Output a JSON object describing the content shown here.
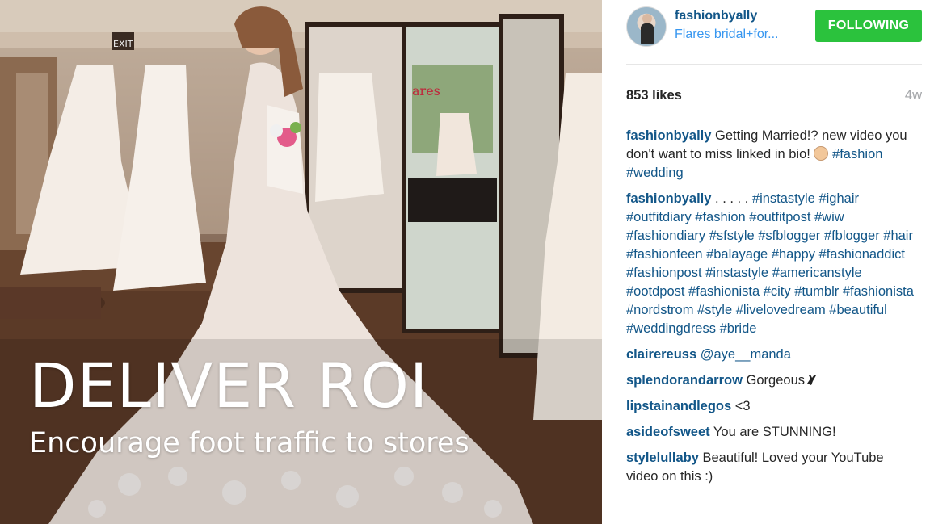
{
  "photo": {
    "headline": "DELIVER ROI",
    "subheadline": "Encourage foot traffic to stores",
    "exit_sign": "EXIT",
    "window_sign": "ares"
  },
  "post": {
    "username": "fashionbyally",
    "location": "Flares bridal+for...",
    "follow_label": "FOLLOWING",
    "likes": "853 likes",
    "age": "4w",
    "colors": {
      "follow_button": "#2bc23d",
      "username": "#125688",
      "location": "#3897f0"
    }
  },
  "comments": [
    {
      "user": "fashionbyally",
      "text": "Getting Married!? new video you don't want to miss linked in bio!",
      "emoji": "face-emoji",
      "tags": "#fashion #wedding"
    },
    {
      "user": "fashionbyally",
      "text": ". . . . .",
      "tags": "#instastyle #ighair #outfitdiary #fashion #outfitpost #wiw #fashiondiary #sfstyle #sfblogger #fblogger #hair #fashionfeen #balayage #happy #fashionaddict #fashionpost #instastyle #americanstyle #ootdpost #fashionista #city #tumblr #fashionista #nordstrom #style #livelovedream #beautiful #weddingdress #bride"
    },
    {
      "user": "clairereuss",
      "text": "@aye__manda"
    },
    {
      "user": "splendorandarrow",
      "text": "Gorgeous",
      "emoji": "ok-hand-emoji"
    },
    {
      "user": "lipstainandlegos",
      "text": "<3"
    },
    {
      "user": "asideofsweet",
      "text": "You are STUNNING!"
    },
    {
      "user": "stylelullaby",
      "text": "Beautiful! Loved your YouTube video on this :)"
    }
  ]
}
